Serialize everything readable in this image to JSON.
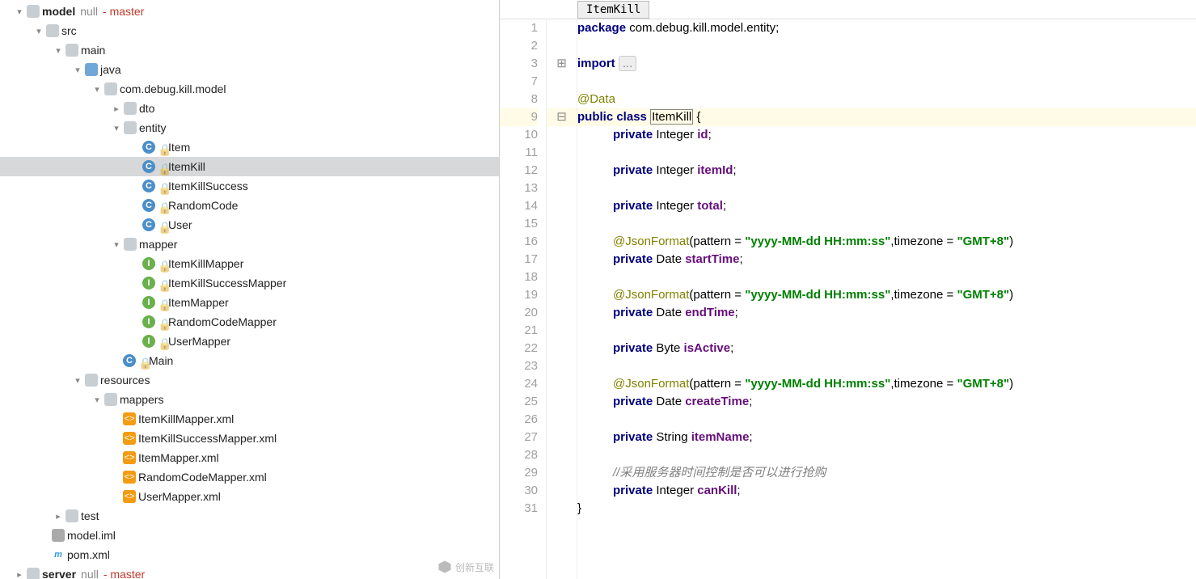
{
  "tree": {
    "model": {
      "name": "model",
      "tag1": "null",
      "tag2": "master"
    },
    "src": "src",
    "main": "main",
    "java": "java",
    "pkg": "com.debug.kill.model",
    "dto": "dto",
    "entity": "entity",
    "entity_items": [
      "Item",
      "ItemKill",
      "ItemKillSuccess",
      "RandomCode",
      "User"
    ],
    "mapper": "mapper",
    "mapper_items": [
      "ItemKillMapper",
      "ItemKillSuccessMapper",
      "ItemMapper",
      "RandomCodeMapper",
      "UserMapper"
    ],
    "main_class": "Main",
    "resources": "resources",
    "mappers_folder": "mappers",
    "xml_files": [
      "ItemKillMapper.xml",
      "ItemKillSuccessMapper.xml",
      "ItemMapper.xml",
      "RandomCodeMapper.xml",
      "UserMapper.xml"
    ],
    "test": "test",
    "iml": "model.iml",
    "pom": "pom.xml",
    "server": {
      "name": "server",
      "tag1": "null",
      "tag2": "master"
    }
  },
  "editor": {
    "breadcrumb": "ItemKill",
    "line_numbers": [
      "1",
      "2",
      "3",
      "7",
      "8",
      "9",
      "10",
      "11",
      "12",
      "13",
      "14",
      "15",
      "16",
      "17",
      "18",
      "19",
      "20",
      "21",
      "22",
      "23",
      "24",
      "25",
      "26",
      "27",
      "28",
      "29",
      "30",
      "31"
    ],
    "package_kw": "package",
    "package_val": " com.debug.kill.model.entity;",
    "import_kw": "import",
    "import_fold": "...",
    "ann_data": "@Data",
    "public": "public ",
    "class": "class ",
    "classname": "ItemKill",
    " brace": " {",
    "priv": "private ",
    "int": "Integer ",
    "date": "Date ",
    "byte": "Byte ",
    "string": "String ",
    "f_id": "id",
    "f_itemId": "itemId",
    "f_total": "total",
    "f_start": "startTime",
    "f_end": "endTime",
    "f_active": "isActive",
    "f_create": "createTime",
    "f_itemName": "itemName",
    "f_canKill": "canKill",
    "semi": ";",
    "jsonformat_pre": "@JsonFormat",
    "jsonformat_paren": "(pattern = ",
    "jsonformat_pattern": "\"yyyy-MM-dd HH:mm:ss\"",
    "jsonformat_mid": ",timezone = ",
    "jsonformat_tz": "\"GMT+8\"",
    "jsonformat_close": ")",
    "comment": "//采用服务器时间控制是否可以进行抢购",
    "close_brace": "}"
  },
  "watermark": "创新互联"
}
